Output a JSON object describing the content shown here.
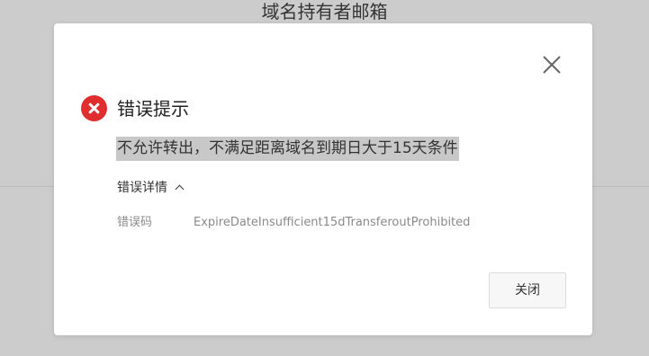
{
  "background": {
    "title": "域名持有者邮箱"
  },
  "dialog": {
    "heading": "错误提示",
    "message": "不允许转出，不满足距离域名到期日大于15天条件",
    "details_label": "错误详情",
    "error_code_label": "错误码",
    "error_code_value": "ExpireDateInsufficient15dTransferoutProhibited",
    "close_button_label": "关闭",
    "icons": {
      "status": "error-icon",
      "close": "close-icon",
      "toggle": "chevron-up-icon"
    },
    "colors": {
      "error": "#e02e2e",
      "message_highlight": "#c8c8c8"
    }
  }
}
